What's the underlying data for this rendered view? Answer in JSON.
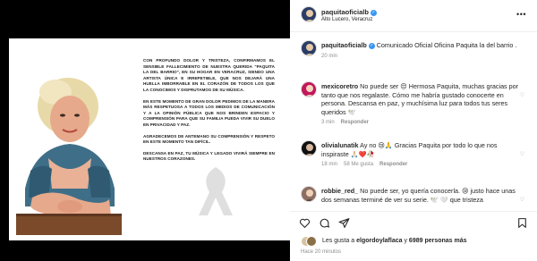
{
  "post": {
    "username": "paquitaoficialb",
    "location": "Alto Lucero, Veracruz",
    "more_label": "•••",
    "verified_mark": "✓"
  },
  "statement": {
    "p1": "Con profundo dolor y tristeza, confirmamos el sensible fallecimiento de nuestra querida \"Paquita la del Barrio\", en su hogar en Veracruz, siendo una artista única e irrepetible, que nos dejará una huella imborrable en el corazón de todos los que la conocimos y disfrutamos de su música.",
    "p2": "En este momento de gran dolor pedimos de la manera más respetuosa a todos los medios de comunicación y a la opinión pública que nos brinden espacio y comprensión para que su familia pueda vivir su duelo en privacidad y paz.",
    "p3": "Agradecemos de antemano su comprensión y respeto en este momento tan difícil.",
    "p4": "Descansa en paz, tu música y legado vivirá siempre en nuestros corazones."
  },
  "caption": {
    "username": "paquitaoficialb",
    "text": "Comunicado Oficial Oficina Paquita la del barrio .",
    "time": "20 min"
  },
  "comments": [
    {
      "username": "mexicoretro",
      "text": "No puede ser 😔 Hermosa Paquita, muchas gracias por tanto que nos regalaste. Cómo me habría gustado conocerte en persona. Descansa en paz, y muchísima luz para todos tus seres queridos 🕊️",
      "time": "3 min",
      "likes": "",
      "reply": "Responder"
    },
    {
      "username": "olivialunatik",
      "text": "Ay no 😢🙏 Gracias Paquita por todo lo que nos inspiraste 🙏🏻❤️🥀",
      "time": "18 min",
      "likes": "58 Me gusta",
      "reply": "Responder"
    },
    {
      "username": "robbie_red_",
      "text": "No puede ser, yo quería conocerla. 😢 justo hace unas dos semanas terminé de ver su serie. 🕊️ 🤍 que tristeza",
      "time": "",
      "likes": "",
      "reply": ""
    }
  ],
  "likes": {
    "prefix": "Les gusta a",
    "user": "elgordoylaflaca",
    "joiner": "y",
    "count": "6989 personas más"
  },
  "timestamp": "Hace 20 minutos",
  "icons": [
    "heart-outline-icon",
    "comment-icon",
    "share-icon",
    "bookmark-icon"
  ]
}
